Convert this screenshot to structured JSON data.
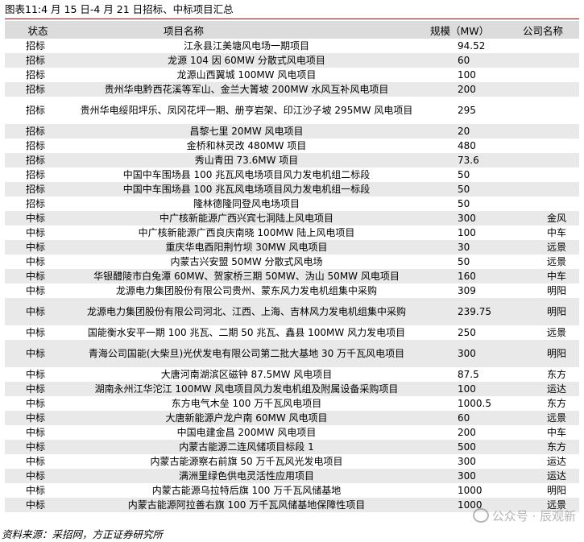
{
  "title": "图表11:4 月 15 日-4 月 21 日招标、中标项目汇总",
  "headers": {
    "status": "状态",
    "name": "项目名称",
    "scale": "规模（MW）",
    "company": "公司名称"
  },
  "rows": [
    {
      "status": "招标",
      "name": "江永县江美塘风电场一期项目",
      "scale": "94.52",
      "company": ""
    },
    {
      "status": "招标",
      "name": "龙源 104 因 60MW 分散式风电项目",
      "scale": "60",
      "company": ""
    },
    {
      "status": "招标",
      "name": "龙源山西翼城 100MW 风电项目",
      "scale": "100",
      "company": ""
    },
    {
      "status": "招标",
      "name": "贵州华电黔西花溪等军山、金兰大箐坡 200MW 水风互补风电项目",
      "scale": "200",
      "company": ""
    },
    {
      "status": "招标",
      "name": "贵州华电绥阳坪乐、凤冈花坪一期、册亨岩架、印江沙子坡 295MW 风电项目",
      "scale": "295",
      "company": ""
    },
    {
      "status": "招标",
      "name": "昌黎七里 20MW 风电项目",
      "scale": "20",
      "company": ""
    },
    {
      "status": "招标",
      "name": "金桥和林灵改 480MW 项目",
      "scale": "480",
      "company": ""
    },
    {
      "status": "招标",
      "name": "秀山青田 73.6MW 项目",
      "scale": "73.6",
      "company": ""
    },
    {
      "status": "招标",
      "name": "中国中车围场县 100 兆瓦风电场项目风力发电机组二标段",
      "scale": "50",
      "company": ""
    },
    {
      "status": "招标",
      "name": "中国中车围场县 100 兆瓦风电场项目风力发电机组一标段",
      "scale": "50",
      "company": ""
    },
    {
      "status": "招标",
      "name": "隆林德隆同登风电场项目",
      "scale": "50",
      "company": ""
    },
    {
      "status": "中标",
      "name": "中广核新能源广西兴宾七洞陆上风电项目",
      "scale": "300",
      "company": "金风"
    },
    {
      "status": "中标",
      "name": "中广核新能源广西良庆南晓 100MW 陆上风电项目",
      "scale": "100",
      "company": "中车"
    },
    {
      "status": "中标",
      "name": "重庆华电酉阳荆竹坝 30MW 风电项目",
      "scale": "30",
      "company": "远景"
    },
    {
      "status": "中标",
      "name": "内蒙古兴安盟 50MW 分散式风电场",
      "scale": "50",
      "company": "远景"
    },
    {
      "status": "中标",
      "name": "华银醴陵市白兔潭 60MW、贺家桥三期 50MW、沩山 50MW 风电项目",
      "scale": "160",
      "company": "中车"
    },
    {
      "status": "中标",
      "name": "龙源电力集团股份有限公司贵州、蒙东风力发电机组集中采购",
      "scale": "309",
      "company": "明阳"
    },
    {
      "status": "中标",
      "name": "龙源电力集团股份有限公司河北、江西、上海、吉林风力发电机组集中采购",
      "scale": "239.75",
      "company": "明阳"
    },
    {
      "status": "中标",
      "name": "国能衡水安平一期 100 兆瓦、二期 50 兆瓦、鑫县 100MW 风力发电项目",
      "scale": "250",
      "company": "远景"
    },
    {
      "status": "中标",
      "name": "青海公司国能(大柴旦)光伏发电有限公司第二批大基地 30 万千瓦风电项目",
      "scale": "300",
      "company": "明阳"
    },
    {
      "status": "中标",
      "name": "大唐河南湖滨区磁钟 87.5MW 风电项目",
      "scale": "87.5",
      "company": "东方"
    },
    {
      "status": "中标",
      "name": "湖南永州江华沱江 100MW 风电项目风力发电机组及附属设备采购项目",
      "scale": "100",
      "company": "运达"
    },
    {
      "status": "中标",
      "name": "东方电气木垒 100 万千瓦风电项目",
      "scale": "1000.5",
      "company": "东方"
    },
    {
      "status": "中标",
      "name": "大唐新能源户龙户南 60MW 风电项目",
      "scale": "60",
      "company": "远景"
    },
    {
      "status": "中标",
      "name": "中国电建金昌 200MW 风电项目",
      "scale": "200",
      "company": "中车"
    },
    {
      "status": "中标",
      "name": "内蒙古能源二连风储项目标段 1",
      "scale": "500",
      "company": "东方"
    },
    {
      "status": "中标",
      "name": "内蒙古能源察右前旗 50 万千瓦风光发电项目",
      "scale": "300",
      "company": "运达"
    },
    {
      "status": "中标",
      "name": "满洲里绿色供电灵活性应用项目",
      "scale": "300",
      "company": "运达"
    },
    {
      "status": "中标",
      "name": "内蒙古能源乌拉特后旗 100 万千瓦风储基地",
      "scale": "1000",
      "company": "明阳"
    },
    {
      "status": "中标",
      "name": "内蒙古能源阿拉善右旗 100 万千瓦风储基地保障性项目",
      "scale": "1000",
      "company": "远景"
    }
  ],
  "footer": "资料来源：采招网，方正证券研究所",
  "watermark": "公众号 · 辰观新"
}
